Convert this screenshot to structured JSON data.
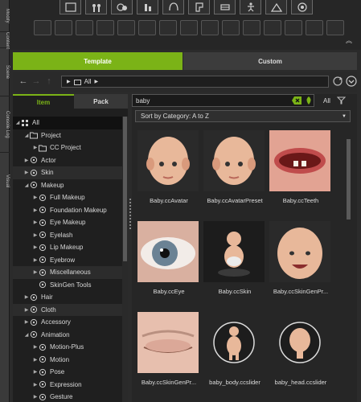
{
  "side_tabs": [
    "Modify",
    "Content",
    "Scene",
    "Console Log",
    "Visual"
  ],
  "tabs": {
    "template": "Template",
    "custom": "Custom"
  },
  "path": {
    "label": "All"
  },
  "left_tabs": {
    "item": "Item",
    "pack": "Pack"
  },
  "tree": [
    {
      "label": "All",
      "level": 0,
      "arrow": "down",
      "icon": "grid-icon"
    },
    {
      "label": "Project",
      "level": 1,
      "arrow": "down",
      "icon": "folder-icon"
    },
    {
      "label": "CC Project",
      "level": 2,
      "arrow": "right",
      "icon": "folder-icon"
    },
    {
      "label": "Actor",
      "level": 1,
      "arrow": "right",
      "icon": "actor-icon"
    },
    {
      "label": "Skin",
      "level": 1,
      "arrow": "right",
      "icon": "skin-icon"
    },
    {
      "label": "Makeup",
      "level": 1,
      "arrow": "down",
      "icon": "makeup-icon"
    },
    {
      "label": "Full Makeup",
      "level": 2,
      "arrow": "right",
      "icon": "full-makeup-icon"
    },
    {
      "label": "Foundation Makeup",
      "level": 2,
      "arrow": "right",
      "icon": "foundation-icon"
    },
    {
      "label": "Eye Makeup",
      "level": 2,
      "arrow": "right",
      "icon": "eye-makeup-icon"
    },
    {
      "label": "Eyelash",
      "level": 2,
      "arrow": "right",
      "icon": "eyelash-icon"
    },
    {
      "label": "Lip Makeup",
      "level": 2,
      "arrow": "right",
      "icon": "lip-icon"
    },
    {
      "label": "Eyebrow",
      "level": 2,
      "arrow": "right",
      "icon": "eyebrow-icon"
    },
    {
      "label": "Miscellaneous",
      "level": 2,
      "arrow": "right",
      "icon": "misc-icon"
    },
    {
      "label": "SkinGen Tools",
      "level": 2,
      "arrow": "",
      "icon": "skingen-icon"
    },
    {
      "label": "Hair",
      "level": 1,
      "arrow": "right",
      "icon": "hair-icon"
    },
    {
      "label": "Cloth",
      "level": 1,
      "arrow": "right",
      "icon": "cloth-icon"
    },
    {
      "label": "Accessory",
      "level": 1,
      "arrow": "right",
      "icon": "accessory-icon"
    },
    {
      "label": "Animation",
      "level": 1,
      "arrow": "down",
      "icon": "animation-icon"
    },
    {
      "label": "Motion-Plus",
      "level": 2,
      "arrow": "right",
      "icon": "motion-plus-icon"
    },
    {
      "label": "Motion",
      "level": 2,
      "arrow": "right",
      "icon": "motion-icon"
    },
    {
      "label": "Pose",
      "level": 2,
      "arrow": "right",
      "icon": "pose-icon"
    },
    {
      "label": "Expression",
      "level": 2,
      "arrow": "right",
      "icon": "expression-icon"
    },
    {
      "label": "Gesture",
      "level": 2,
      "arrow": "right",
      "icon": "gesture-icon"
    }
  ],
  "search": {
    "value": "baby",
    "filter_label": "All"
  },
  "sort": {
    "label": "Sort by Category: A to Z"
  },
  "items": [
    {
      "caption": "Baby.ccAvatar",
      "kind": "baby-head"
    },
    {
      "caption": "Baby.ccAvatarPreset",
      "kind": "baby-head"
    },
    {
      "caption": "Baby.ccTeeth",
      "kind": "teeth"
    },
    {
      "caption": "Baby.ccEye",
      "kind": "eye"
    },
    {
      "caption": "Baby.ccSkin",
      "kind": "baby-body-dark"
    },
    {
      "caption": "Baby.ccSkinGenPr...",
      "kind": "baby-smile"
    },
    {
      "caption": "Baby.ccSkinGenPr...",
      "kind": "closed-eye"
    },
    {
      "caption": "baby_body.ccslider",
      "kind": "body-slider"
    },
    {
      "caption": "baby_head.ccslider",
      "kind": "head-slider"
    }
  ],
  "colors": {
    "accent": "#7bb317",
    "selected_row": "#111111"
  }
}
